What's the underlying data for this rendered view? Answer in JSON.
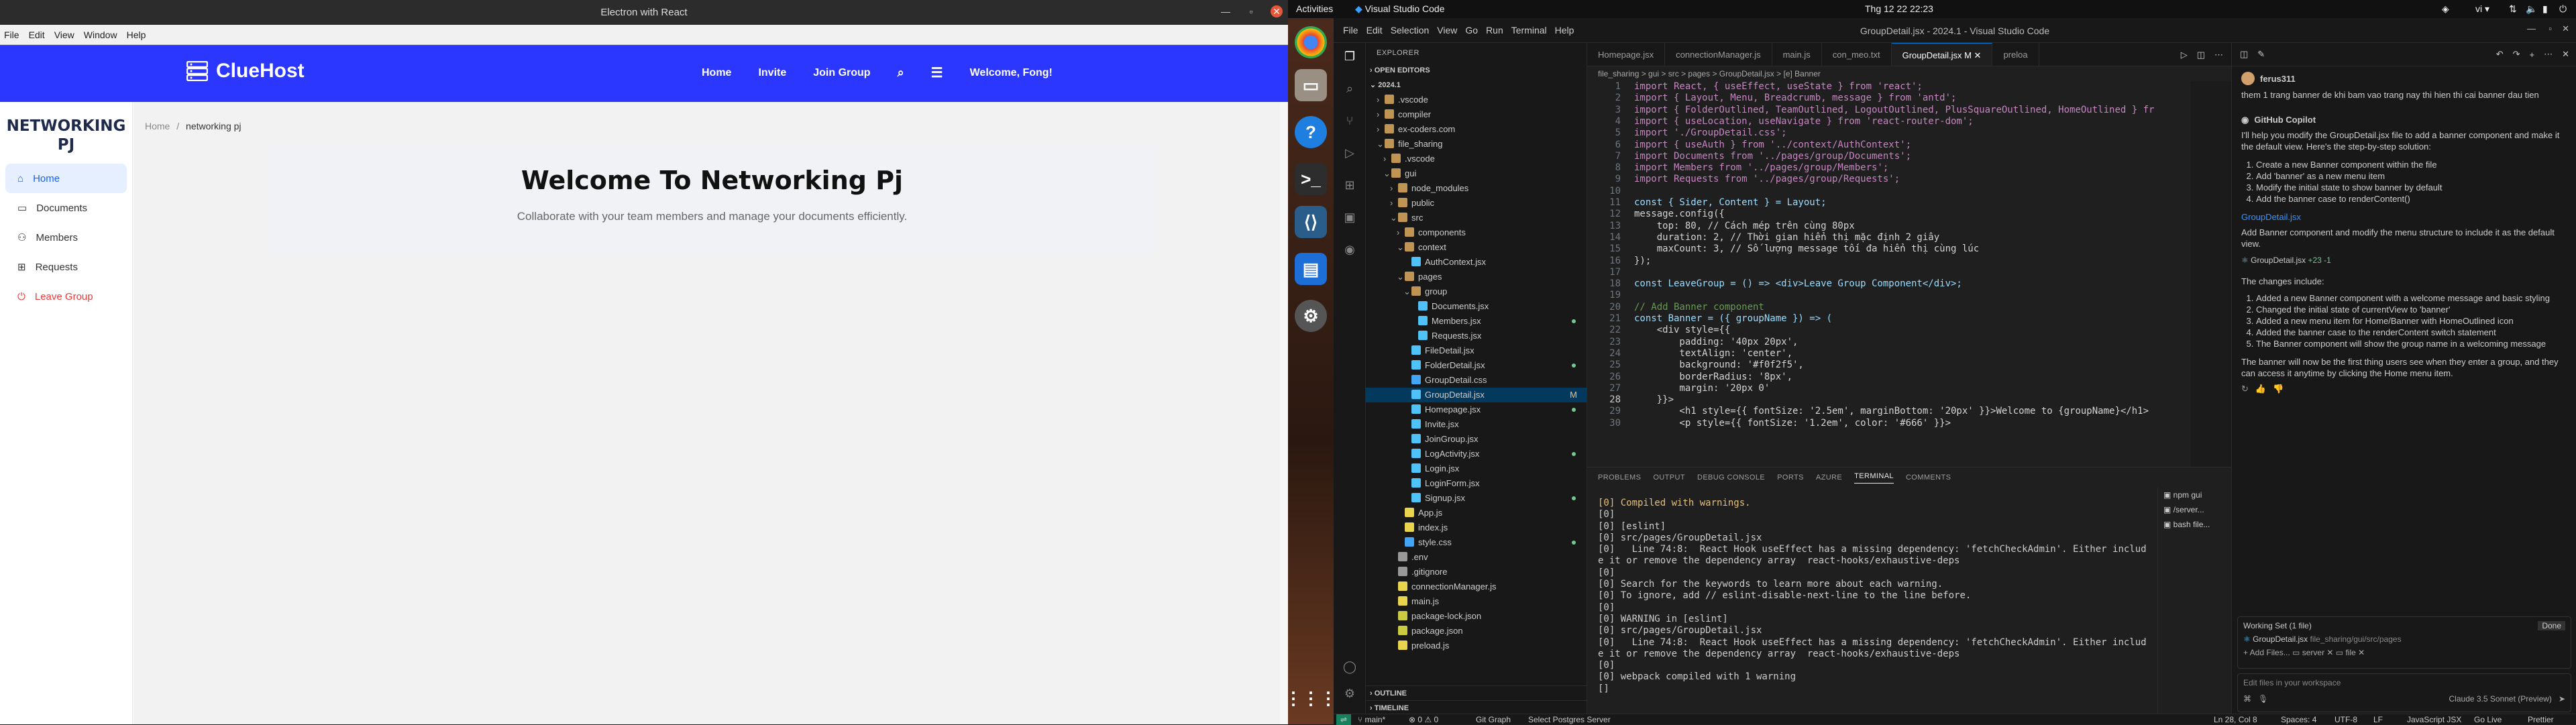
{
  "electron": {
    "title": "Electron with React",
    "menu": [
      "File",
      "Edit",
      "View",
      "Window",
      "Help"
    ],
    "logo": "ClueHost",
    "nav": [
      "Home",
      "Invite",
      "Join Group"
    ],
    "welcome": "Welcome, Fong!",
    "brand_line1": "NETWORKING",
    "brand_line2": "PJ",
    "sidebar": [
      {
        "label": "Home",
        "icon": "home-icon"
      },
      {
        "label": "Documents",
        "icon": "file-icon"
      },
      {
        "label": "Members",
        "icon": "team-icon"
      },
      {
        "label": "Requests",
        "icon": "mail-icon"
      },
      {
        "label": "Leave Group",
        "icon": "logout-icon"
      }
    ],
    "breadcrumb_home": "Home",
    "breadcrumb_sep": "/",
    "breadcrumb_current": "networking pj",
    "banner_title": "Welcome To Networking Pj",
    "banner_sub": "Collaborate with your team members and manage your documents efficiently."
  },
  "topbar": {
    "activities": "Activities",
    "app": "Visual Studio Code",
    "clock": "Thg 12 22  22:23",
    "lang": "vi"
  },
  "vscode": {
    "window_title": "GroupDetail.jsx - 2024.1 - Visual Studio Code",
    "menu": [
      "File",
      "Edit",
      "Selection",
      "View",
      "Go",
      "Run",
      "Terminal",
      "Help"
    ],
    "explorer_title": "EXPLORER",
    "open_editors": "OPEN EDITORS",
    "root": "2024.1",
    "tree": [
      {
        "t": ".vscode",
        "d": 1,
        "k": "folder"
      },
      {
        "t": "compiler",
        "d": 1,
        "k": "folder"
      },
      {
        "t": "ex-coders.com",
        "d": 1,
        "k": "folder"
      },
      {
        "t": "file_sharing",
        "d": 1,
        "k": "folder",
        "open": true
      },
      {
        "t": ".vscode",
        "d": 2,
        "k": "folder"
      },
      {
        "t": "gui",
        "d": 2,
        "k": "folder",
        "open": true
      },
      {
        "t": "node_modules",
        "d": 3,
        "k": "folder"
      },
      {
        "t": "public",
        "d": 3,
        "k": "folder"
      },
      {
        "t": "src",
        "d": 3,
        "k": "folder",
        "open": true
      },
      {
        "t": "components",
        "d": 4,
        "k": "folder"
      },
      {
        "t": "context",
        "d": 4,
        "k": "folder",
        "open": true
      },
      {
        "t": "AuthContext.jsx",
        "d": 5,
        "k": "jsx"
      },
      {
        "t": "pages",
        "d": 4,
        "k": "folder",
        "open": true
      },
      {
        "t": "group",
        "d": 5,
        "k": "folder",
        "open": true
      },
      {
        "t": "Documents.jsx",
        "d": 6,
        "k": "jsx"
      },
      {
        "t": "Members.jsx",
        "d": 6,
        "k": "jsx"
      },
      {
        "t": "Requests.jsx",
        "d": 6,
        "k": "jsx"
      },
      {
        "t": "FileDetail.jsx",
        "d": 5,
        "k": "jsx"
      },
      {
        "t": "FolderDetail.jsx",
        "d": 5,
        "k": "jsx"
      },
      {
        "t": "GroupDetail.css",
        "d": 5,
        "k": "css"
      },
      {
        "t": "GroupDetail.jsx",
        "d": 5,
        "k": "jsx",
        "sel": true,
        "badge": "M"
      },
      {
        "t": "Homepage.jsx",
        "d": 5,
        "k": "jsx"
      },
      {
        "t": "Invite.jsx",
        "d": 5,
        "k": "jsx"
      },
      {
        "t": "JoinGroup.jsx",
        "d": 5,
        "k": "jsx"
      },
      {
        "t": "LogActivity.jsx",
        "d": 5,
        "k": "jsx"
      },
      {
        "t": "Login.jsx",
        "d": 5,
        "k": "jsx"
      },
      {
        "t": "LoginForm.jsx",
        "d": 5,
        "k": "jsx"
      },
      {
        "t": "Signup.jsx",
        "d": 5,
        "k": "jsx"
      },
      {
        "t": "App.js",
        "d": 4,
        "k": "js"
      },
      {
        "t": "index.js",
        "d": 4,
        "k": "js"
      },
      {
        "t": "style.css",
        "d": 4,
        "k": "css"
      },
      {
        "t": ".env",
        "d": 3,
        "k": "cfg"
      },
      {
        "t": ".gitignore",
        "d": 3,
        "k": "cfg"
      },
      {
        "t": "connectionManager.js",
        "d": 3,
        "k": "js"
      },
      {
        "t": "main.js",
        "d": 3,
        "k": "js"
      },
      {
        "t": "package-lock.json",
        "d": 3,
        "k": "json"
      },
      {
        "t": "package.json",
        "d": 3,
        "k": "json"
      },
      {
        "t": "preload.js",
        "d": 3,
        "k": "js"
      }
    ],
    "outline": "OUTLINE",
    "timeline": "TIMELINE",
    "tabs": [
      "Homepage.jsx",
      "connectionManager.js",
      "main.js",
      "con_meo.txt",
      "GroupDetail.jsx M",
      "preloa"
    ],
    "breadcrumb": "file_sharing > gui > src > pages > GroupDetail.jsx > [e] Banner",
    "code": [
      "import React, { useEffect, useState } from 'react';",
      "import { Layout, Menu, Breadcrumb, message } from 'antd';",
      "import { FolderOutlined, TeamOutlined, LogoutOutlined, PlusSquareOutlined, HomeOutlined } fr",
      "import { useLocation, useNavigate } from 'react-router-dom';",
      "import './GroupDetail.css';",
      "import { useAuth } from '../context/AuthContext';",
      "import Documents from '../pages/group/Documents';",
      "import Members from '../pages/group/Members';",
      "import Requests from '../pages/group/Requests';",
      "",
      "const { Sider, Content } = Layout;",
      "message.config({",
      "    top: 80, // Cách mép trên cùng 80px",
      "    duration: 2, // Thời gian hiển thị mặc định 2 giây",
      "    maxCount: 3, // Số lượng message tối đa hiển thị cùng lúc",
      "});",
      "",
      "const LeaveGroup = () => <div>Leave Group Component</div>;",
      "",
      "// Add Banner component",
      "const Banner = ({ groupName }) => (",
      "    <div style={{",
      "        padding: '40px 20px',",
      "        textAlign: 'center',",
      "        background: '#f0f2f5',",
      "        borderRadius: '8px',",
      "        margin: '20px 0'",
      "    }}>",
      "        <h1 style={{ fontSize: '2.5em', marginBottom: '20px' }}>Welcome to {groupName}</h1>",
      "        <p style={{ fontSize: '1.2em', color: '#666' }}>"
    ],
    "panel_tabs": [
      "PROBLEMS",
      "OUTPUT",
      "DEBUG CONSOLE",
      "PORTS",
      "AZURE",
      "TERMINAL",
      "COMMENTS"
    ],
    "terminal": [
      "[0] Compiled with warnings.",
      "[0]",
      "[0] [eslint]",
      "[0] src/pages/GroupDetail.jsx",
      "[0]   Line 74:8:  React Hook useEffect has a missing dependency: 'fetchCheckAdmin'. Either includ",
      "e it or remove the dependency array  react-hooks/exhaustive-deps",
      "[0]",
      "[0] Search for the keywords to learn more about each warning.",
      "[0] To ignore, add // eslint-disable-next-line to the line before.",
      "[0]",
      "[0] WARNING in [eslint]",
      "[0] src/pages/GroupDetail.jsx",
      "[0]   Line 74:8:  React Hook useEffect has a missing dependency: 'fetchCheckAdmin'. Either includ",
      "e it or remove the dependency array  react-hooks/exhaustive-deps",
      "[0]",
      "[0] webpack compiled with 1 warning",
      "[]"
    ],
    "terminals": [
      "npm gui",
      "/server...",
      "bash file..."
    ],
    "chat": {
      "user": "ferus311",
      "user_msg": "them 1 trang banner de khi bam vao trang nay thi hien thi cai banner dau tien",
      "bot": "GitHub Copilot",
      "intro": "I'll help you modify the GroupDetail.jsx file to add a banner component and make it the default view. Here's the step-by-step solution:",
      "steps": [
        "Create a new Banner component within the file",
        "Add 'banner' as a new menu item",
        "Modify the initial state to show banner by default",
        "Add the banner case to renderContent()"
      ],
      "file": "GroupDetail.jsx",
      "desc": "Add Banner component and modify the menu structure to include it as the default view.",
      "changes_title": "The changes include:",
      "changes": [
        "Added a new Banner component with a welcome message and basic styling",
        "Changed the initial state of currentView to 'banner'",
        "Added a new menu item for Home/Banner with HomeOutlined icon",
        "Added the banner case to the renderContent switch statement",
        "The Banner component will show the group name in a welcoming message"
      ],
      "outro": "The banner will now be the first thing users see when they enter a group, and they can access it anytime by clicking the Home menu item.",
      "working_set": "Working Set (1 file)",
      "ws_file": "GroupDetail.jsx",
      "ws_path": "file_sharing/gui/src/pages",
      "done": "Done",
      "input_placeholder": "Edit files in your workspace",
      "model": "Claude 3.5 Sonnet (Preview)"
    },
    "status": {
      "branch": "main*",
      "errors": "⊗ 0 ⚠ 0",
      "graph": "Git Graph",
      "db": "Select Postgres Server",
      "pos": "Ln 28, Col 8",
      "spaces": "Spaces: 4",
      "enc": "UTF-8",
      "eol": "LF",
      "lang": "JavaScript JSX",
      "live": "Go Live",
      "prettier": "Prettier"
    }
  }
}
